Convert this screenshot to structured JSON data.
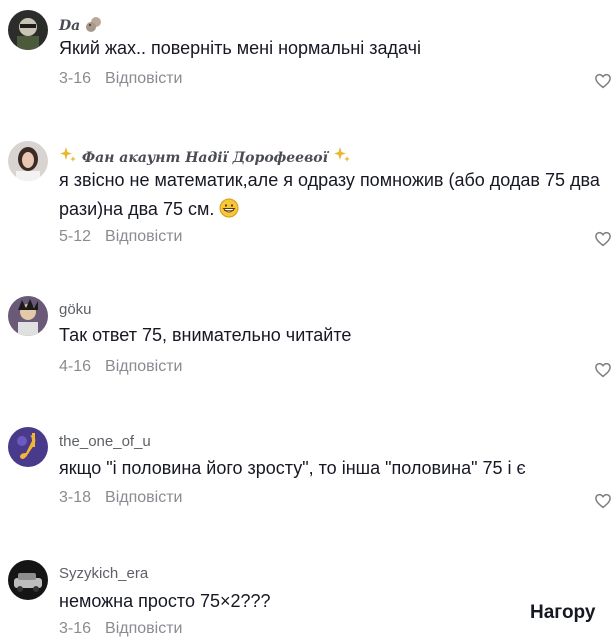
{
  "comments": [
    {
      "username": "Da",
      "username_emoji": "squirrel-emoji",
      "text": "Який жах.. поверніть мені нормальні задачі",
      "date": "3-16",
      "reply_label": "Відповісти"
    },
    {
      "username": "Фан акаунт Надії Дорофеевої",
      "username_emoji": "sparkles-emoji",
      "text": "я звісно не математик,але я одразу помножив (або додав 75 два рази)на два 75 см.",
      "text_emoji": "grinning-face-emoji",
      "date": "5-12",
      "reply_label": "Відповісти"
    },
    {
      "username": "göku",
      "text": "Так ответ 75, внимательно читайте",
      "date": "4-16",
      "reply_label": "Відповісти"
    },
    {
      "username": "the_one_of_u",
      "text": "якщо \"і половина його зросту\", то інша \"половина\" 75 і є",
      "date": "3-18",
      "reply_label": "Відповісти"
    },
    {
      "username": "Syzykich_era",
      "text": "неможна просто 75×2???",
      "date": "3-16",
      "reply_label": "Відповісти"
    }
  ],
  "scroll_top_label": "Нагору",
  "icons": {
    "like": "heart-outline-icon"
  },
  "colors": {
    "text": "#161823",
    "secondary": "#8a8b91",
    "background": "#ffffff"
  }
}
